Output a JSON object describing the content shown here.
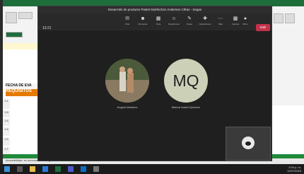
{
  "call": {
    "title": "Desarrollo de producto Pastel Salchichón Andersen Cifras - Segan",
    "timer": "13:21",
    "toolbar": [
      {
        "label": "Chat",
        "icon": "chat-icon"
      },
      {
        "label": "Personas",
        "icon": "people-icon"
      },
      {
        "label": "Vista",
        "icon": "view-icon"
      },
      {
        "label": "Reacciones",
        "icon": "reactions-icon"
      },
      {
        "label": "Notas",
        "icon": "notes-icon"
      },
      {
        "label": "Aplicaciones",
        "icon": "apps-icon"
      },
      {
        "label": "Más",
        "icon": "more-icon"
      },
      {
        "label": "Cámara",
        "icon": "camera-icon"
      },
      {
        "label": "Micro",
        "icon": "mic-icon"
      },
      {
        "label": "Compartir",
        "icon": "share-icon"
      }
    ],
    "leave_label": "Salir",
    "participants": [
      {
        "name": "Angela Martinez"
      },
      {
        "name": "Marina Isabel Quintero",
        "initials": "MQ"
      }
    ]
  },
  "excel": {
    "header_fecha": "FECHA DE EVA",
    "header_req": "REQUISITOS",
    "row_numbers": [
      "1.1",
      "1.6",
      "1.6",
      "1.6",
      "1.6",
      "1.7"
    ],
    "statusbar": "Accesibilidad: es necesario investigar"
  },
  "taskbar": {
    "time": "2:04 p. m.",
    "date": "12/07/2023"
  },
  "colors": {
    "accent": "#c4314b",
    "excel": "#1e6e3c",
    "avatar_bg": "#ccd0b7"
  }
}
